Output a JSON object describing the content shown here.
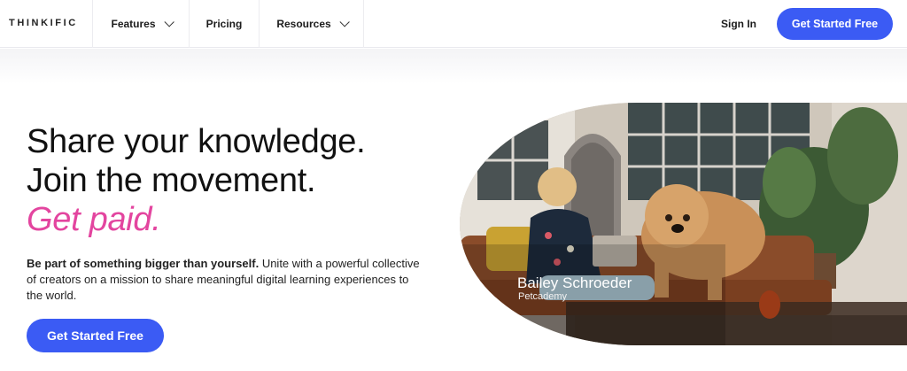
{
  "nav": {
    "logo": "THINKIFIC",
    "features": "Features",
    "pricing": "Pricing",
    "resources": "Resources",
    "sign_in": "Sign In",
    "cta": "Get Started Free"
  },
  "hero": {
    "line1": "Share your knowledge.",
    "line2": "Join the movement.",
    "line3": "Get paid.",
    "sub_bold": "Be part of something bigger than yourself.",
    "sub_rest": " Unite with a powerful collective of creators on a mission to share meaningful digital learning experiences to the world.",
    "cta": "Get Started Free",
    "caption_name": "Bailey Schroeder",
    "caption_sub": "Petcademy"
  },
  "colors": {
    "accent": "#3b5bf4",
    "pink": "#e3459f"
  }
}
